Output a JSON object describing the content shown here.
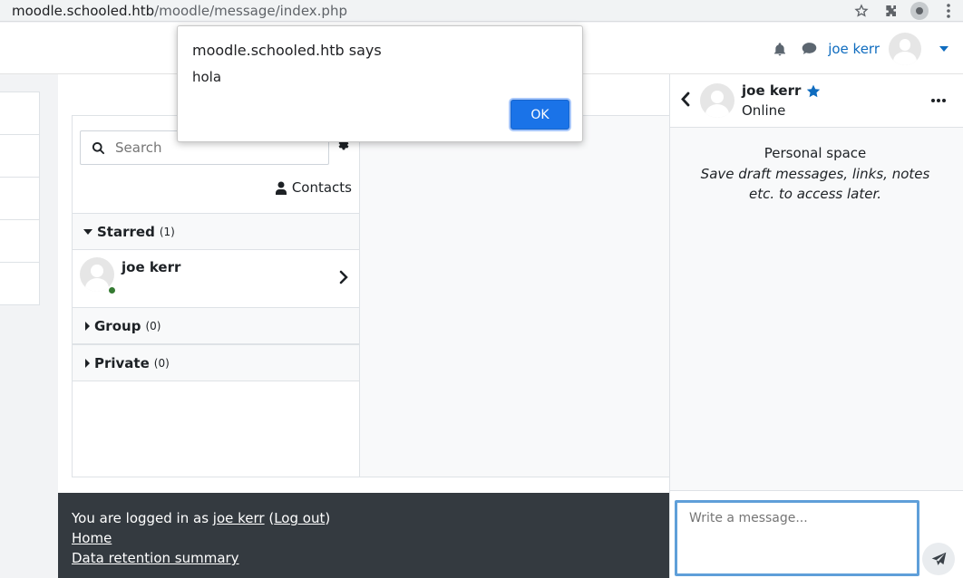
{
  "browser": {
    "url_host": "moodle.schooled.htb",
    "url_path": "/moodle/message/index.php"
  },
  "navbar": {
    "user_name": "joe kerr"
  },
  "messaging": {
    "search_placeholder": "Search",
    "contacts_label": "Contacts",
    "sections": {
      "starred": {
        "label": "Starred",
        "count": "(1)"
      },
      "group": {
        "label": "Group",
        "count": "(0)"
      },
      "private": {
        "label": "Private",
        "count": "(0)"
      }
    },
    "starred_contacts": [
      {
        "name": "joe kerr"
      }
    ]
  },
  "dialog": {
    "title": "moodle.schooled.htb says",
    "message": "hola",
    "ok_label": "OK"
  },
  "drawer": {
    "contact_name": "joe kerr",
    "status": "Online",
    "personal_space_title": "Personal space",
    "personal_space_desc": "Save draft messages, links, notes etc. to access later.",
    "message_placeholder": "Write a message..."
  },
  "footer": {
    "logged_in_prefix": "You are logged in as",
    "user_link": "joe kerr",
    "logout_link": "Log out",
    "home_link": "Home",
    "data_retention_link": "Data retention summary"
  },
  "colors": {
    "accent": "#0f6cbf",
    "dialog_button": "#1a73e8",
    "online": "#357a32",
    "footer_bg": "#343a40"
  }
}
